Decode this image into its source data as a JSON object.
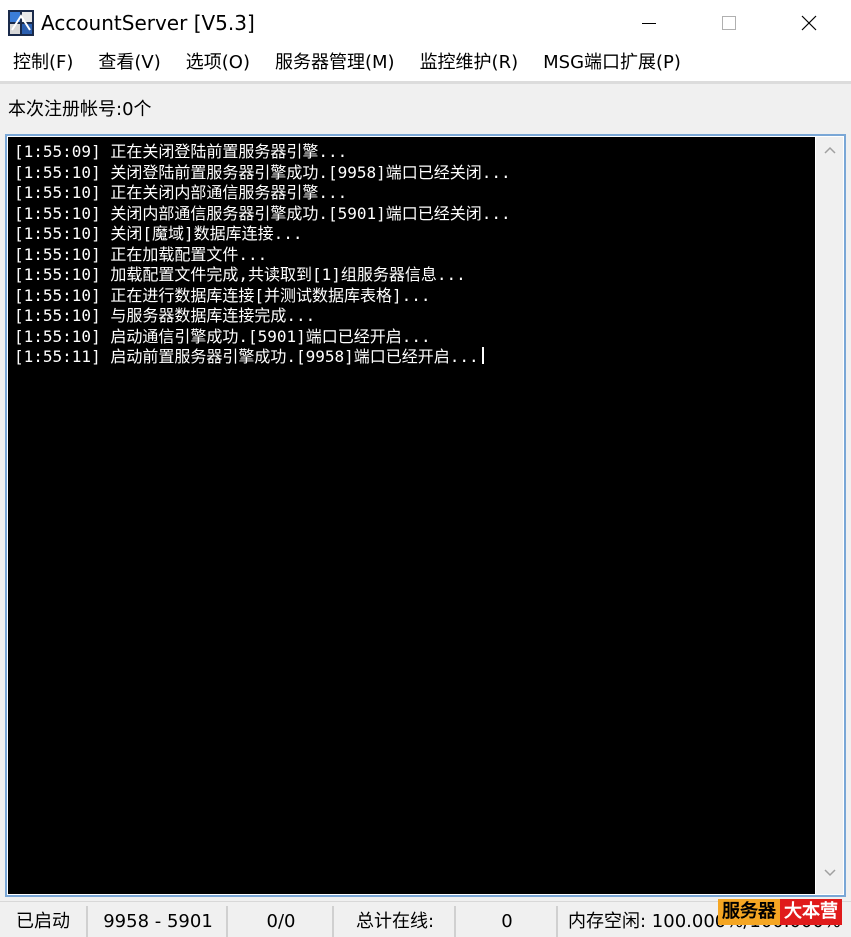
{
  "window": {
    "title": "AccountServer [V5.3]"
  },
  "menu": [
    {
      "label": "控制(F)"
    },
    {
      "label": "查看(V)"
    },
    {
      "label": "选项(O)"
    },
    {
      "label": "服务器管理(M)"
    },
    {
      "label": "监控维护(R)"
    },
    {
      "label": "MSG端口扩展(P)"
    }
  ],
  "registration": {
    "label": "本次注册帐号:0个"
  },
  "log": [
    "[1:55:09] 正在关闭登陆前置服务器引擎...",
    "[1:55:10] 关闭登陆前置服务器引擎成功.[9958]端口已经关闭...",
    "[1:55:10] 正在关闭内部通信服务器引擎...",
    "[1:55:10] 关闭内部通信服务器引擎成功.[5901]端口已经关闭...",
    "[1:55:10] 关闭[魔域]数据库连接...",
    "[1:55:10] 正在加载配置文件...",
    "[1:55:10] 加载配置文件完成,共读取到[1]组服务器信息...",
    "[1:55:10] 正在进行数据库连接[并测试数据库表格]...",
    "[1:55:10] 与服务器数据库连接完成...",
    "[1:55:10] 启动通信引擎成功.[5901]端口已经开启...",
    "[1:55:11] 启动前置服务器引擎成功.[9958]端口已经开启..."
  ],
  "status": {
    "state": "已启动",
    "ports": "9958 - 5901",
    "ratio": "0/0",
    "online_label": "总计在线:",
    "online_value": "0",
    "memory": "内存空闲: 100.000%/100.000%"
  },
  "watermark": {
    "part1": "服务器",
    "part2": "大本营"
  },
  "colors": {
    "console_bg": "#000000",
    "console_text": "#ffffff",
    "frame_border": "#7aa7d6",
    "watermark_orange": "#f5a623",
    "watermark_red": "#e01b1b"
  },
  "icons": {
    "app": "app-icon",
    "minimize": "minimize-icon",
    "maximize": "maximize-icon",
    "close": "close-icon",
    "scroll_up": "chevron-up-icon",
    "scroll_down": "chevron-down-icon"
  }
}
